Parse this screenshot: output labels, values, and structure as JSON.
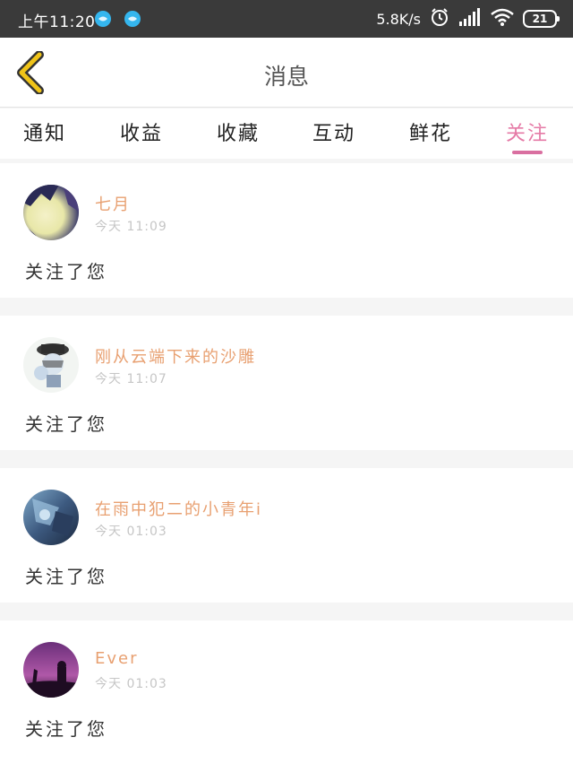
{
  "status_bar": {
    "time": "上午11:20",
    "network_speed": "5.8K/s",
    "battery": "21",
    "icons": [
      "notification-dot-icon",
      "notification-dot-icon",
      "alarm-icon",
      "signal-icon",
      "wifi-icon",
      "battery-icon"
    ],
    "dot_color": "#35b6ee"
  },
  "header": {
    "title": "消息",
    "back_icon": "chevron-left-icon",
    "back_icon_color": "#f0c419"
  },
  "tabs": [
    {
      "label": "通知",
      "active": false
    },
    {
      "label": "收益",
      "active": false
    },
    {
      "label": "收藏",
      "active": false
    },
    {
      "label": "互动",
      "active": false
    },
    {
      "label": "鲜花",
      "active": false
    },
    {
      "label": "关注",
      "active": true
    }
  ],
  "accent_color": "#e57aa6",
  "username_color": "#e8a071",
  "notifications": [
    {
      "username": "七月",
      "time": "今天 11:09",
      "message": "关注了您"
    },
    {
      "username": "刚从云端下来的沙雕",
      "time": "今天 11:07",
      "message": "关注了您"
    },
    {
      "username": "在雨中犯二的小青年i",
      "time": "今天 01:03",
      "message": "关注了您"
    },
    {
      "username": "Ever",
      "time": "今天 01:03",
      "message": "关注了您"
    }
  ]
}
